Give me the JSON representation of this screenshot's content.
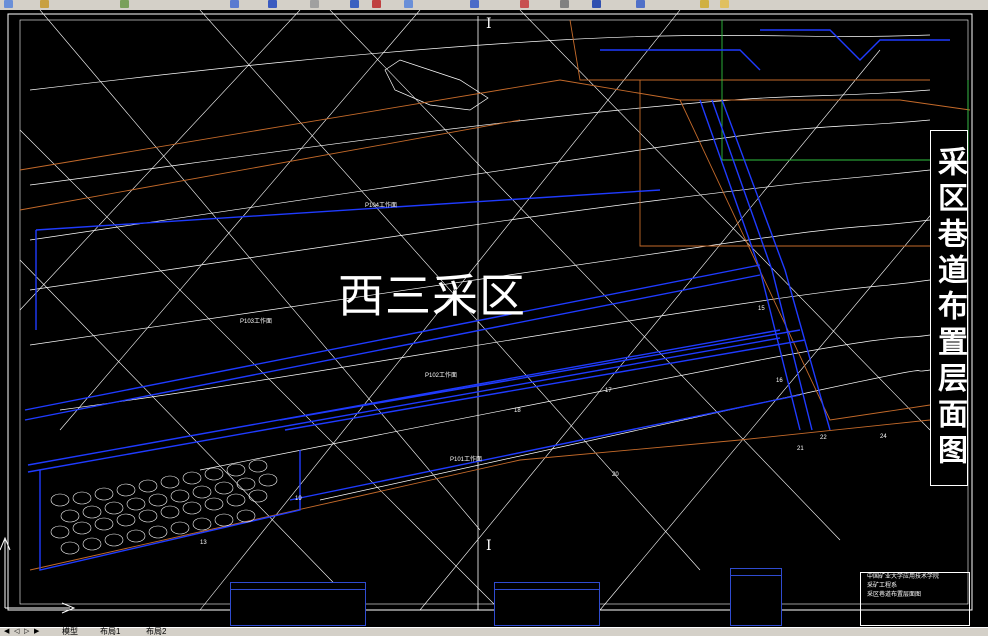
{
  "drawing": {
    "region_label": "西三采区",
    "title_vertical": "采区巷道布置层面图",
    "section_mark_top": "I",
    "section_mark_bottom": "I",
    "workface_labels": [
      "P104工作面",
      "P103工作面",
      "P102工作面",
      "P101工作面"
    ],
    "point_numbers": [
      "13",
      "15",
      "16",
      "17",
      "18",
      "19",
      "20",
      "21",
      "22",
      "24"
    ]
  },
  "title_block": {
    "school": "中国矿业大学应用技术学院",
    "course": "采矿工程系",
    "drawing_name": "采区巷道布置层面图"
  },
  "tabs": {
    "model": "模型",
    "layout1": "布局1",
    "layout2": "布局2"
  },
  "colors": {
    "canvas_bg": "#000000",
    "roadway_blue": "#1f3bff",
    "contour_white": "#ffffff",
    "boundary_orange": "#c46a2a",
    "frame_green": "#2fbf3f"
  }
}
